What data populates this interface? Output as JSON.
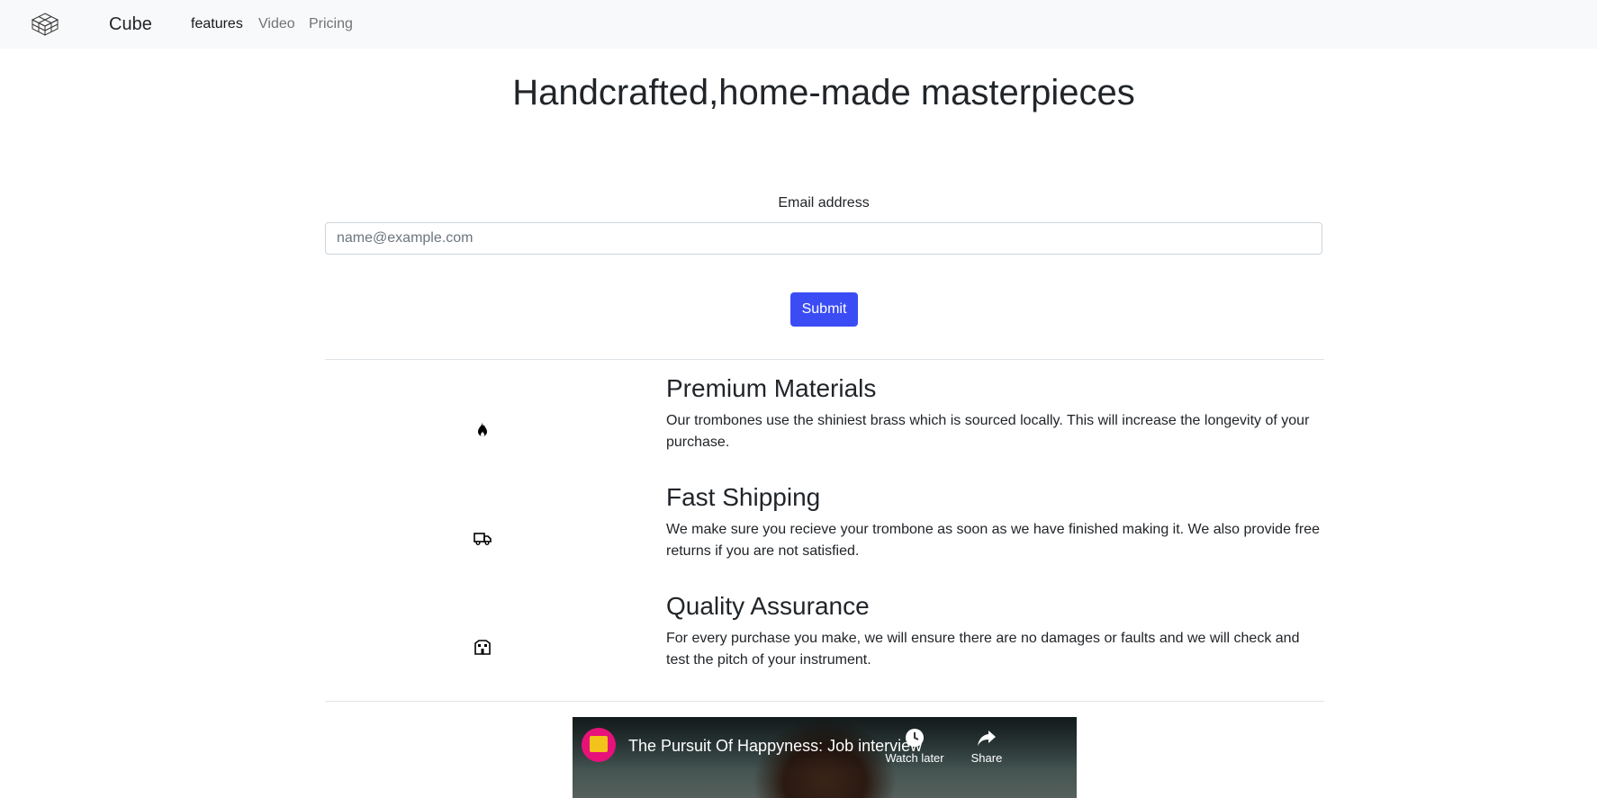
{
  "navbar": {
    "brand": "Cube",
    "links": [
      {
        "label": "features",
        "active": true
      },
      {
        "label": "Video",
        "active": false
      },
      {
        "label": "Pricing",
        "active": false
      }
    ]
  },
  "hero": {
    "title": "Handcrafted,home-made masterpieces"
  },
  "form": {
    "email_label": "Email address",
    "email_placeholder": "name@example.com",
    "email_value": "",
    "submit_label": "Submit"
  },
  "features": [
    {
      "icon": "fire-icon",
      "title": "Premium Materials",
      "description": "Our trombones use the shiniest brass which is sourced locally. This will increase the longevity of your purchase."
    },
    {
      "icon": "truck-icon",
      "title": "Fast Shipping",
      "description": "We make sure you recieve your trombone as soon as we have finished making it. We also provide free returns if you are not satisfied."
    },
    {
      "icon": "building-icon",
      "title": "Quality Assurance",
      "description": "For every purchase you make, we will ensure there are no damages or faults and we will check and test the pitch of your instrument."
    }
  ],
  "video": {
    "title": "The Pursuit Of Happyness: Job interview",
    "watch_later_label": "Watch later",
    "share_label": "Share"
  },
  "colors": {
    "navbar_bg": "#f8f9fa",
    "primary_button": "#3b4cf5",
    "divider": "#dee2e6"
  }
}
